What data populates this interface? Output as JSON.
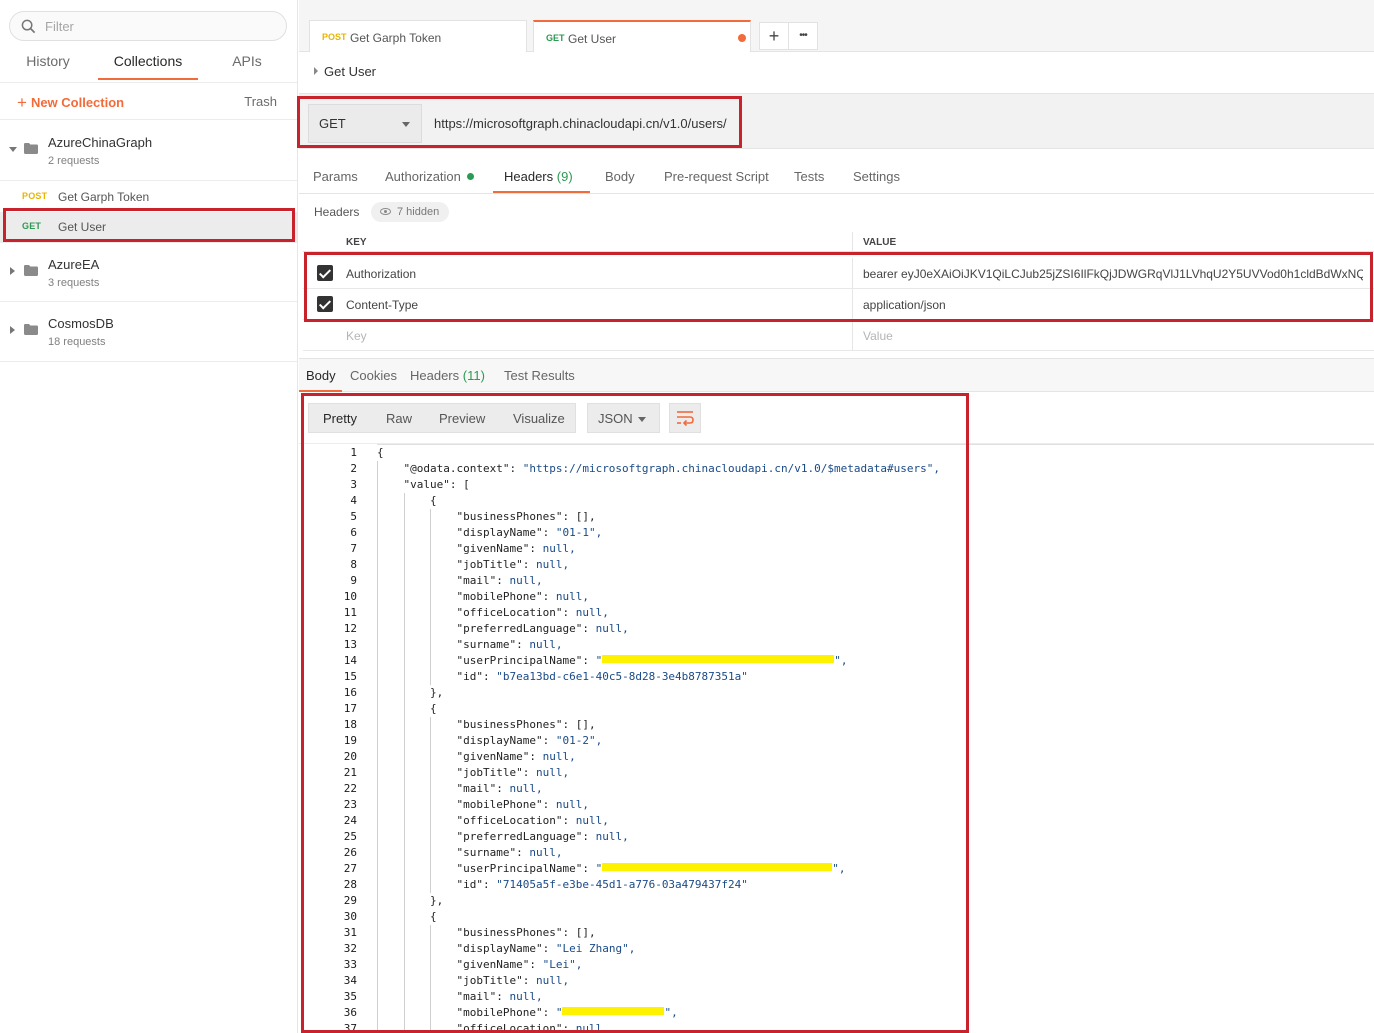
{
  "sidebar": {
    "filter_placeholder": "Filter",
    "tabs": [
      "History",
      "Collections",
      "APIs"
    ],
    "active_tab": "Collections",
    "new_collection_label": "New Collection",
    "trash_label": "Trash",
    "collections": [
      {
        "name": "AzureChinaGraph",
        "count": "2 requests",
        "expanded": true,
        "requests": [
          {
            "method": "POST",
            "name": "Get Garph Token"
          },
          {
            "method": "GET",
            "name": "Get User",
            "selected": true
          }
        ]
      },
      {
        "name": "AzureEA",
        "count": "3 requests",
        "expanded": false
      },
      {
        "name": "CosmosDB",
        "count": "18 requests",
        "expanded": false
      }
    ]
  },
  "tabs": [
    {
      "method": "POST",
      "name": "Get Garph Token"
    },
    {
      "method": "GET",
      "name": "Get User",
      "active": true,
      "unsaved": true
    }
  ],
  "tab_actions": {
    "add": "+",
    "more": "•••"
  },
  "breadcrumb": "Get User",
  "request": {
    "method": "GET",
    "url": "https://microsoftgraph.chinacloudapi.cn/v1.0/users/"
  },
  "request_tabs": {
    "params": "Params",
    "authorization": "Authorization",
    "headers": "Headers",
    "headers_count": "(9)",
    "body": "Body",
    "prerequest": "Pre-request Script",
    "tests": "Tests",
    "settings": "Settings"
  },
  "headers_section": {
    "label": "Headers",
    "hidden": "7 hidden",
    "col_key": "KEY",
    "col_value": "VALUE",
    "rows": [
      {
        "key": "Authorization",
        "value": "bearer eyJ0eXAiOiJKV1QiLCJub25jZSI6IlFkQjJDWGRqVlJ1LVhqU2Y5UVVod0h1cldBdWxNQ ...",
        "checked": true
      },
      {
        "key": "Content-Type",
        "value": "application/json",
        "checked": true
      }
    ],
    "key_placeholder": "Key",
    "value_placeholder": "Value"
  },
  "response_tabs": {
    "body": "Body",
    "cookies": "Cookies",
    "headers": "Headers",
    "headers_count": "(11)",
    "test_results": "Test Results"
  },
  "response_toolbar": {
    "pretty": "Pretty",
    "raw": "Raw",
    "preview": "Preview",
    "visualize": "Visualize",
    "language": "JSON"
  },
  "response_lines": [
    {
      "n": "1",
      "indent": 0,
      "k": "",
      "v": "{",
      "t": "p"
    },
    {
      "n": "2",
      "indent": 1,
      "k": "\"@odata.context\"",
      "v": "\"https://microsoftgraph.chinacloudapi.cn/v1.0/$metadata#users\",",
      "t": "s"
    },
    {
      "n": "3",
      "indent": 1,
      "k": "\"value\"",
      "v": "[",
      "t": "p"
    },
    {
      "n": "4",
      "indent": 2,
      "k": "",
      "v": "{",
      "t": "p"
    },
    {
      "n": "5",
      "indent": 3,
      "k": "\"businessPhones\"",
      "v": "[],",
      "t": "p"
    },
    {
      "n": "6",
      "indent": 3,
      "k": "\"displayName\"",
      "v": "\"01-1\",",
      "t": "s"
    },
    {
      "n": "7",
      "indent": 3,
      "k": "\"givenName\"",
      "v": "null,",
      "t": "n"
    },
    {
      "n": "8",
      "indent": 3,
      "k": "\"jobTitle\"",
      "v": "null,",
      "t": "n"
    },
    {
      "n": "9",
      "indent": 3,
      "k": "\"mail\"",
      "v": "null,",
      "t": "n"
    },
    {
      "n": "10",
      "indent": 3,
      "k": "\"mobilePhone\"",
      "v": "null,",
      "t": "n"
    },
    {
      "n": "11",
      "indent": 3,
      "k": "\"officeLocation\"",
      "v": "null,",
      "t": "n"
    },
    {
      "n": "12",
      "indent": 3,
      "k": "\"preferredLanguage\"",
      "v": "null,",
      "t": "n"
    },
    {
      "n": "13",
      "indent": 3,
      "k": "\"surname\"",
      "v": "null,",
      "t": "n"
    },
    {
      "n": "14",
      "indent": 3,
      "k": "\"userPrincipalName\"",
      "v": "",
      "t": "r",
      "rw": 232
    },
    {
      "n": "15",
      "indent": 3,
      "k": "\"id\"",
      "v": "\"b7ea13bd-c6e1-40c5-8d28-3e4b8787351a\"",
      "t": "s"
    },
    {
      "n": "16",
      "indent": 2,
      "k": "",
      "v": "},",
      "t": "p"
    },
    {
      "n": "17",
      "indent": 2,
      "k": "",
      "v": "{",
      "t": "p"
    },
    {
      "n": "18",
      "indent": 3,
      "k": "\"businessPhones\"",
      "v": "[],",
      "t": "p"
    },
    {
      "n": "19",
      "indent": 3,
      "k": "\"displayName\"",
      "v": "\"01-2\",",
      "t": "s"
    },
    {
      "n": "20",
      "indent": 3,
      "k": "\"givenName\"",
      "v": "null,",
      "t": "n"
    },
    {
      "n": "21",
      "indent": 3,
      "k": "\"jobTitle\"",
      "v": "null,",
      "t": "n"
    },
    {
      "n": "22",
      "indent": 3,
      "k": "\"mail\"",
      "v": "null,",
      "t": "n"
    },
    {
      "n": "23",
      "indent": 3,
      "k": "\"mobilePhone\"",
      "v": "null,",
      "t": "n"
    },
    {
      "n": "24",
      "indent": 3,
      "k": "\"officeLocation\"",
      "v": "null,",
      "t": "n"
    },
    {
      "n": "25",
      "indent": 3,
      "k": "\"preferredLanguage\"",
      "v": "null,",
      "t": "n"
    },
    {
      "n": "26",
      "indent": 3,
      "k": "\"surname\"",
      "v": "null,",
      "t": "n"
    },
    {
      "n": "27",
      "indent": 3,
      "k": "\"userPrincipalName\"",
      "v": "",
      "t": "r",
      "rw": 230
    },
    {
      "n": "28",
      "indent": 3,
      "k": "\"id\"",
      "v": "\"71405a5f-e3be-45d1-a776-03a479437f24\"",
      "t": "s"
    },
    {
      "n": "29",
      "indent": 2,
      "k": "",
      "v": "},",
      "t": "p"
    },
    {
      "n": "30",
      "indent": 2,
      "k": "",
      "v": "{",
      "t": "p"
    },
    {
      "n": "31",
      "indent": 3,
      "k": "\"businessPhones\"",
      "v": "[],",
      "t": "p"
    },
    {
      "n": "32",
      "indent": 3,
      "k": "\"displayName\"",
      "v": "\"Lei Zhang\",",
      "t": "s"
    },
    {
      "n": "33",
      "indent": 3,
      "k": "\"givenName\"",
      "v": "\"Lei\",",
      "t": "s"
    },
    {
      "n": "34",
      "indent": 3,
      "k": "\"jobTitle\"",
      "v": "null,",
      "t": "n"
    },
    {
      "n": "35",
      "indent": 3,
      "k": "\"mail\"",
      "v": "null,",
      "t": "n"
    },
    {
      "n": "36",
      "indent": 3,
      "k": "\"mobilePhone\"",
      "v": "",
      "t": "r",
      "rw": 102
    },
    {
      "n": "37",
      "indent": 3,
      "k": "\"officeLocation\"",
      "v": "null,",
      "t": "n"
    }
  ],
  "colors": {
    "accent": "#f26b3a",
    "get": "#2b9a52",
    "post": "#e8b500",
    "annotation": "#c8232c",
    "redaction": "#fff200"
  }
}
